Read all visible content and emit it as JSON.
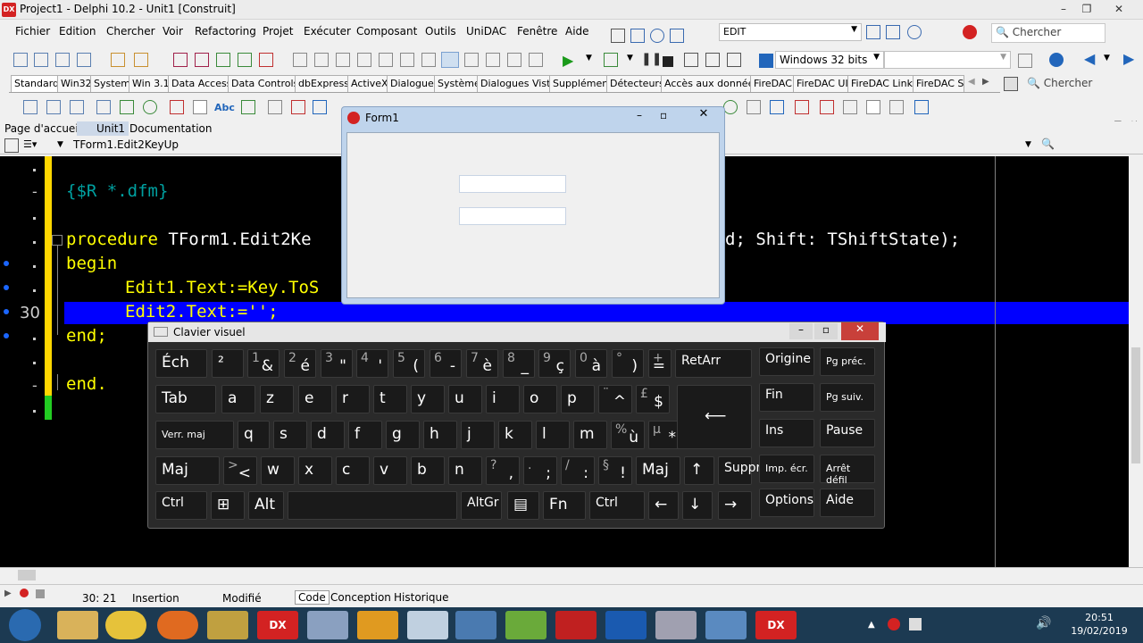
{
  "window": {
    "title": "Project1 - Delphi 10.2 - Unit1 [Construit]",
    "logo": "DX"
  },
  "menu": [
    "Fichier",
    "Edition",
    "Chercher",
    "Voir",
    "Refactoring",
    "Projet",
    "Exécuter",
    "Composant",
    "Outils",
    "UniDAC",
    "Fenêtre",
    "Aide"
  ],
  "edit_combo": "EDIT",
  "search_top": "Chercher",
  "platform": "Windows 32 bits",
  "palette_tabs": [
    "Standard",
    "Win32",
    "System",
    "Win 3.1",
    "Data Access",
    "Data Controls",
    "dbExpress",
    "ActiveX",
    "Dialogues",
    "Système",
    "Dialogues Vista",
    "Supplément",
    "Détecteurs",
    "Accès aux données",
    "FireDAC",
    "FireDAC UI",
    "FireDAC Links",
    "FireDAC Se"
  ],
  "palette_search": "Chercher",
  "doc_tabs": [
    "Page d'accueil",
    "Unit1",
    "Documentation"
  ],
  "proc_combo": "TForm1.Edit2KeyUp",
  "code": {
    "line1": "{$R *.dfm}",
    "line2a": "procedure",
    "line2b": " TForm1.Edit2Ke",
    "line2c": "d; Shift: TShiftState);",
    "line3": "begin",
    "line4": "Edit1.Text:=Key.ToS",
    "line5": "Edit2.Text:='';",
    "line6": "end;",
    "line7": "end.",
    "line_number": "30"
  },
  "form1": {
    "title": "Form1"
  },
  "osk": {
    "title": "Clavier visuel",
    "row1": [
      {
        "main": "Éch"
      },
      {
        "main": "²"
      },
      {
        "sup": "1",
        "sub": "&"
      },
      {
        "sup": "2",
        "sub": "é"
      },
      {
        "sup": "3",
        "sub": "\""
      },
      {
        "sup": "4",
        "sub": "'"
      },
      {
        "sup": "5",
        "sub": "("
      },
      {
        "sup": "6",
        "sub": "-"
      },
      {
        "sup": "7",
        "sub": "è"
      },
      {
        "sup": "8",
        "sub": "_"
      },
      {
        "sup": "9",
        "sub": "ç"
      },
      {
        "sup": "0",
        "sub": "à"
      },
      {
        "sup": "°",
        "sub": ")"
      },
      {
        "sup": "+",
        "sub": "="
      },
      {
        "main": "RetArr"
      }
    ],
    "row2": [
      {
        "main": "Tab"
      },
      {
        "main": "a"
      },
      {
        "main": "z"
      },
      {
        "main": "e"
      },
      {
        "main": "r"
      },
      {
        "main": "t"
      },
      {
        "main": "y"
      },
      {
        "main": "u"
      },
      {
        "main": "i"
      },
      {
        "main": "o"
      },
      {
        "main": "p"
      },
      {
        "sup": "¨",
        "sub": "^"
      },
      {
        "sup": "£",
        "sub": "$"
      }
    ],
    "row3": [
      {
        "main": "Verr. maj"
      },
      {
        "main": "q"
      },
      {
        "main": "s"
      },
      {
        "main": "d"
      },
      {
        "main": "f"
      },
      {
        "main": "g"
      },
      {
        "main": "h"
      },
      {
        "main": "j"
      },
      {
        "main": "k"
      },
      {
        "main": "l"
      },
      {
        "main": "m"
      },
      {
        "sup": "%",
        "sub": "ù"
      },
      {
        "sup": "µ",
        "sub": "*"
      }
    ],
    "row4": [
      {
        "main": "Maj"
      },
      {
        "sup": ">",
        "sub": "<"
      },
      {
        "main": "w"
      },
      {
        "main": "x"
      },
      {
        "main": "c"
      },
      {
        "main": "v"
      },
      {
        "main": "b"
      },
      {
        "main": "n"
      },
      {
        "sup": "?",
        "sub": ","
      },
      {
        "sup": ".",
        "sub": ";"
      },
      {
        "sup": "/",
        "sub": ":"
      },
      {
        "sup": "§",
        "sub": "!"
      },
      {
        "main": "Maj"
      },
      {
        "main": "↑"
      },
      {
        "main": "Suppr"
      }
    ],
    "row5": [
      {
        "main": "Ctrl"
      },
      {
        "main": "⊞"
      },
      {
        "main": "Alt"
      },
      {
        "main": ""
      },
      {
        "main": "AltGr"
      },
      {
        "main": "▤"
      },
      {
        "main": "Fn"
      },
      {
        "main": "Ctrl"
      },
      {
        "main": "←"
      },
      {
        "main": "↓"
      },
      {
        "main": "→"
      }
    ],
    "side": [
      "Origine",
      "Pg préc.",
      "Fin",
      "Pg suiv.",
      "Ins",
      "Pause",
      "Imp. écr.",
      "Arrêt défil",
      "Options",
      "Aide"
    ]
  },
  "status": {
    "pos": "30: 21",
    "mode": "Insertion",
    "state": "Modifié",
    "views": [
      "Code",
      "Conception",
      "Historique"
    ]
  },
  "clock": {
    "time": "20:51",
    "date": "19/02/2019"
  },
  "colors": {
    "editor_bg": "#000000",
    "keyword": "#ffff00",
    "selection": "#0000ff",
    "osk_bg": "#2a2a2a"
  }
}
